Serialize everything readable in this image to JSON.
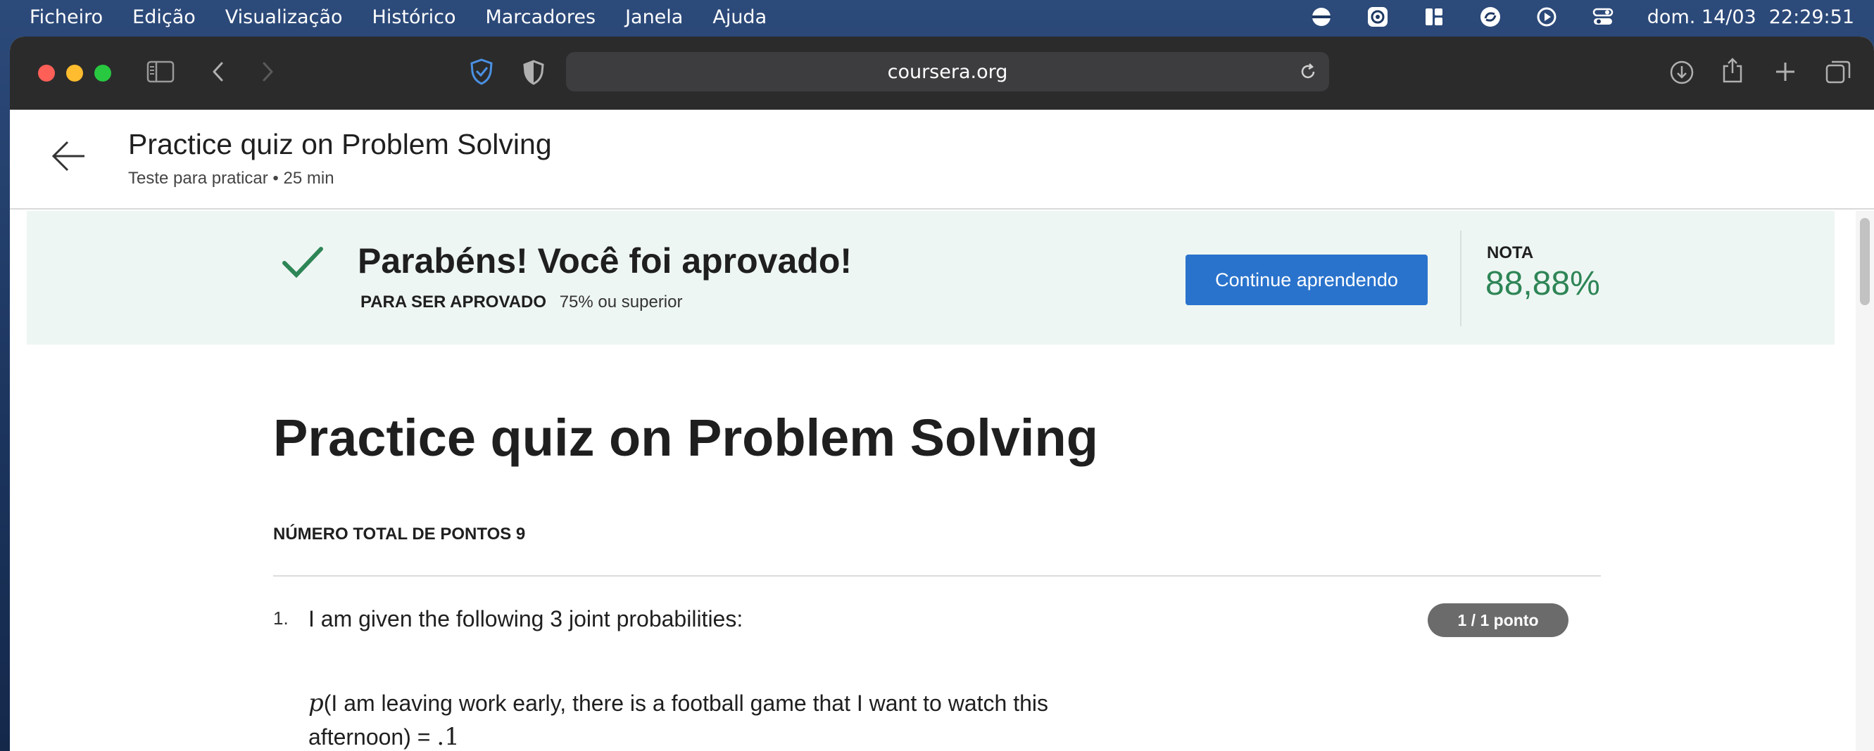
{
  "menubar": {
    "items": [
      "Ficheiro",
      "Edição",
      "Visualização",
      "Histórico",
      "Marcadores",
      "Janela",
      "Ajuda"
    ],
    "clock": {
      "date": "dom. 14/03",
      "time": "22:29:51"
    },
    "tray_icons": [
      "vpn-icon",
      "compass-app-icon",
      "window-layout-icon",
      "sync-icon",
      "play-circle-icon",
      "control-center-icon"
    ]
  },
  "browser": {
    "url": "coursera.org",
    "colors": {
      "toolbar": "#2b2b2c",
      "address_bar": "#3d3d3f",
      "privacy_shield": "#4a90e2"
    }
  },
  "header": {
    "title": "Practice quiz on Problem Solving",
    "subtitle": "Teste para praticar • 25 min"
  },
  "banner": {
    "title": "Parabéns! Você foi aprovado!",
    "pass_label": "PARA SER APROVADO",
    "pass_value": "75% ou superior",
    "continue_label": "Continue aprendendo",
    "grade_label": "NOTA",
    "grade_value": "88,88%",
    "colors": {
      "background": "#eef6f3",
      "check": "#2e8556",
      "grade": "#2e8556",
      "button": "#2a73cc"
    }
  },
  "quiz": {
    "title": "Practice quiz on Problem Solving",
    "total_points": "NÚMERO TOTAL DE PONTOS 9",
    "questions": [
      {
        "number": "1.",
        "text": "I am given the following 3 joint probabilities:",
        "points": "1 / 1 ponto",
        "probability_symbol": "p",
        "probability_text": "(I am leaving work early, there is a football game that I want to watch this afternoon) = ",
        "probability_value": ".1"
      }
    ]
  }
}
